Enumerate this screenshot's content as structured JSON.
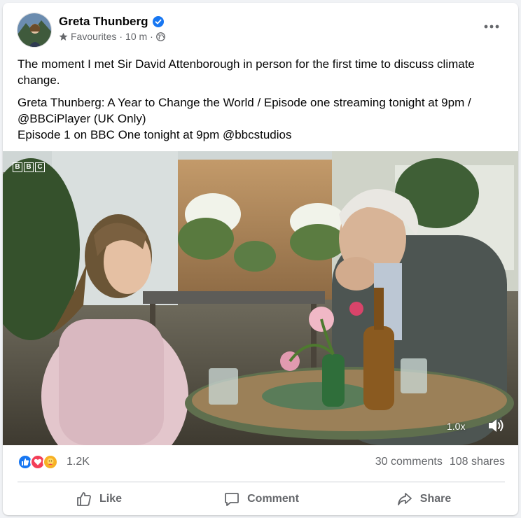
{
  "post": {
    "author": "Greta Thunberg",
    "audience_label": "Favourites",
    "separator": "·",
    "time": "10 m",
    "separator2": "·",
    "paragraphs": [
      "The moment I met Sir David Attenborough in person for the first time to discuss climate change.",
      "Greta Thunberg: A Year to Change the World / Episode one streaming tonight at 9pm / @BBCiPlayer (UK Only)",
      "Episode 1 on BBC One tonight at 9pm @bbcstudios"
    ]
  },
  "video": {
    "watermark": [
      "B",
      "B",
      "C"
    ],
    "speed": "1.0x",
    "icons": {
      "volume": "volume-icon"
    }
  },
  "stats": {
    "reaction_count": "1.2K",
    "comments": "30 comments",
    "shares": "108 shares",
    "reactions": [
      "like",
      "love",
      "care"
    ]
  },
  "actions": {
    "like": "Like",
    "comment": "Comment",
    "share": "Share"
  },
  "colors": {
    "brand_blue": "#1877f2",
    "love_red": "#f33e58",
    "care_yellow": "#f7b125",
    "muted_text": "#65676b"
  }
}
